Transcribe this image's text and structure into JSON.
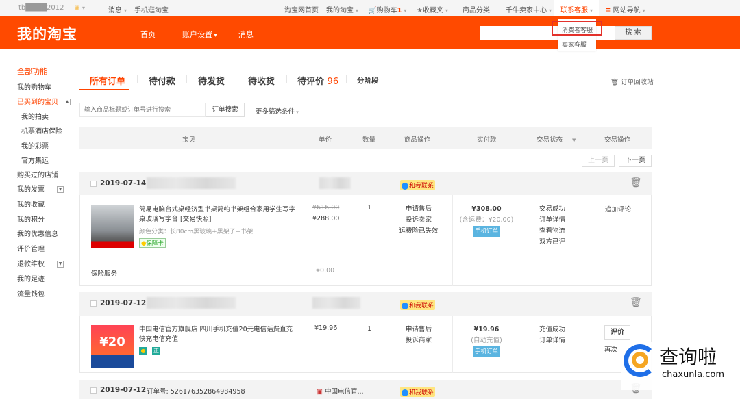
{
  "topbar": {
    "user": "tb████2012",
    "messages": "消息",
    "mobile": "手机逛淘宝",
    "home": "淘宝网首页",
    "my_taobao": "我的淘宝",
    "cart": "购物车",
    "cart_count": "1",
    "favorites": "收藏夹",
    "categories": "商品分类",
    "seller_center": "千牛卖家中心",
    "customer_service": "联系客服",
    "site_nav": "网站导航"
  },
  "header": {
    "logo": "我的淘宝",
    "nav": [
      "首页",
      "账户设置",
      "消息"
    ],
    "search_button": "搜 索",
    "search_value": ""
  },
  "dropdown": {
    "items": [
      "消费者客服",
      "卖家客服"
    ]
  },
  "sidebar": {
    "title": "全部功能",
    "items": [
      "我的购物车",
      "已买到的宝贝",
      "我的拍卖",
      "机票酒店保险",
      "我的彩票",
      "官方集运",
      "购买过的店铺",
      "我的发票",
      "我的收藏",
      "我的积分",
      "我的优惠信息",
      "评价管理",
      "退款维权",
      "我的足迹",
      "流量钱包"
    ]
  },
  "tabs": [
    {
      "label": "所有订单"
    },
    {
      "label": "待付款"
    },
    {
      "label": "待发货"
    },
    {
      "label": "待收货"
    },
    {
      "label": "待评价",
      "count": "96"
    },
    {
      "label": "分阶段"
    }
  ],
  "recycle": "订单回收站",
  "filter": {
    "placeholder": "输入商品标题或订单号进行搜索",
    "search": "订单搜索",
    "more": "更多筛选条件"
  },
  "columns": [
    "宝贝",
    "单价",
    "数量",
    "商品操作",
    "实付款",
    "交易状态",
    "交易操作"
  ],
  "pager": {
    "prev": "上一页",
    "next": "下一页"
  },
  "contact_label": "和我联系",
  "orders": [
    {
      "date": "2019-07-14",
      "title": "简易电脑台式桌经济型书桌简约书架组合家用学生写字桌玻璃写字台 [交易快照]",
      "sku": "颜色分类：长80cm黑玻璃+黑架子+书架",
      "badge": "保障卡",
      "orig_price": "¥616.00",
      "price": "¥288.00",
      "qty": "1",
      "ops": [
        "申请售后",
        "投诉卖家",
        "运费险已失效"
      ],
      "total": "¥308.00",
      "total_note": "(含运费：¥20.00)",
      "tag": "手机订单",
      "status": [
        "交易成功",
        "订单详情",
        "查看物流",
        "双方已评"
      ],
      "actions": [
        "追加评论"
      ],
      "extra_label": "保险服务",
      "extra_price": "¥0.00"
    },
    {
      "date": "2019-07-12",
      "title": "中国电信官方旗舰店 四川手机充值20元电信话费直充快充电信充值",
      "badge": "正",
      "img_text": "¥20",
      "price": "¥19.96",
      "qty": "1",
      "ops": [
        "申请售后",
        "投诉商家"
      ],
      "total": "¥19.96",
      "total_note": "(自动充值)",
      "tag": "手机订单",
      "status": [
        "充值成功",
        "订单详情"
      ],
      "action_button": "评价",
      "actions": [
        "再次"
      ]
    },
    {
      "date": "2019-07-12",
      "order_no_label": "订单号:",
      "order_no": "526176352864984958",
      "shop": "中国电信官..."
    }
  ],
  "watermark": {
    "name": "查询啦",
    "url": "chaxunla.com"
  }
}
